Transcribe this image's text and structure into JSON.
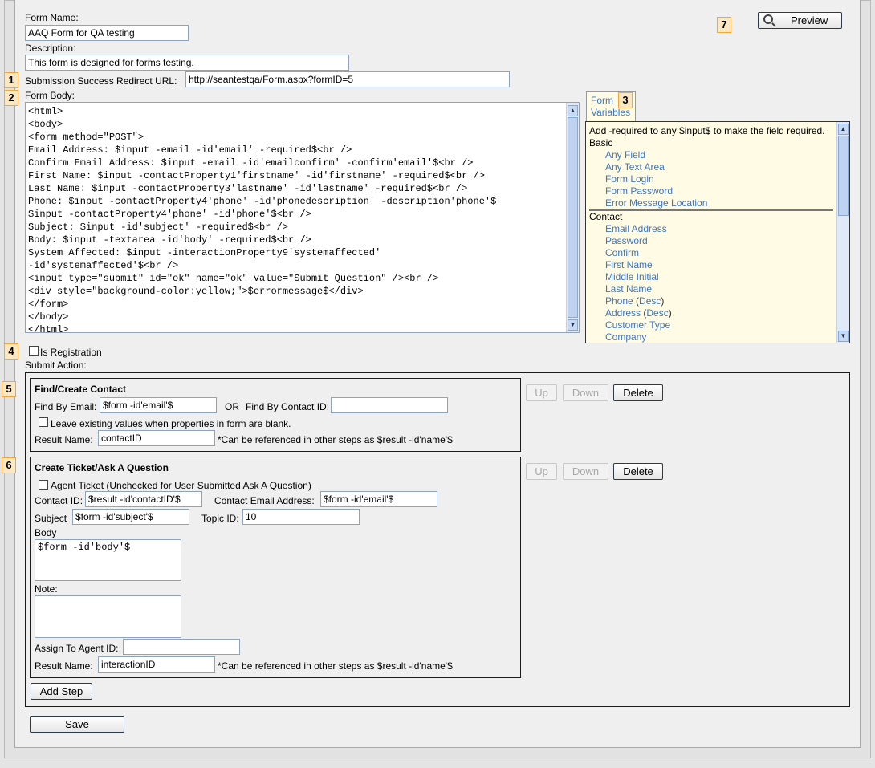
{
  "form_name": {
    "label": "Form Name:",
    "value": "AAQ Form for QA testing"
  },
  "description": {
    "label": "Description:",
    "value": "This form is designed for forms testing."
  },
  "redirect": {
    "label": "Submission Success Redirect URL:",
    "value": "http://seantestqa/Form.aspx?formID=5"
  },
  "form_body": {
    "label": "Form Body:",
    "lines": [
      "<html>",
      "<body>",
      "<form method=\"POST\">",
      "Email Address: $input -email -id'email' -required$<br />",
      "Confirm Email Address: $input -email -id'emailconfirm' -confirm'email'$<br />",
      "First Name: $input -contactProperty1'firstname' -id'firstname' -required$<br />",
      "Last Name: $input -contactProperty3'lastname' -id'lastname' -required$<br />",
      "Phone: $input -contactProperty4'phone' -id'phonedescription' -description'phone'$",
      "$input -contactProperty4'phone' -id'phone'$<br />",
      "Subject: $input -id'subject' -required$<br />",
      "Body: $input -textarea -id'body' -required$<br />",
      "System Affected: $input -interactionProperty9'systemaffected'",
      "-id'systemaffected'$<br />",
      "<input type=\"submit\" id=\"ok\" name=\"ok\" value=\"Submit Question\" /><br />",
      "<div style=\"background-color:yellow;\">$errormessage$</div>",
      "</form>",
      "</body>",
      "</html>"
    ]
  },
  "variables": {
    "tab_line1": "Form",
    "tab_line2": "Variables",
    "hint": "Add -required to any $input$ to make the field required.",
    "basic_title": "Basic",
    "basic_items": [
      "Any Field",
      "Any Text Area",
      "Form Login",
      "Form Password",
      "Error Message Location"
    ],
    "contact_title": "Contact",
    "contact_items": [
      "Email Address",
      "Password",
      "Confirm",
      "First Name",
      "Middle Initial",
      "Last Name",
      "Phone",
      "Address",
      "Customer Type",
      "Company"
    ],
    "desc": "Desc"
  },
  "markers": [
    "1",
    "2",
    "3",
    "4",
    "5",
    "6",
    "7"
  ],
  "preview_label": "Preview",
  "is_registration": "Is Registration",
  "submit_action": "Submit Action:",
  "step1": {
    "title": "Find/Create Contact",
    "find_email_label": "Find By Email:",
    "find_email_value": "$form -id'email'$",
    "or": "OR",
    "find_id_label": "Find By Contact ID:",
    "find_id_value": "",
    "leave_label": "Leave existing values when properties in form are blank.",
    "result_label": "Result Name:",
    "result_value": "contactID",
    "result_note": "*Can be referenced in other steps as $result -id'name'$"
  },
  "step2": {
    "title": "Create Ticket/Ask A Question",
    "agent_label": "Agent Ticket (Unchecked for User Submitted Ask A Question)",
    "contact_id_label": "Contact ID:",
    "contact_id_value": "$result -id'contactID'$",
    "contact_email_label": "Contact Email Address:",
    "contact_email_value": "$form -id'email'$",
    "subject_label": "Subject",
    "subject_value": "$form -id'subject'$",
    "topic_label": "Topic ID:",
    "topic_value": "10",
    "body_label": "Body",
    "body_value": "$form -id'body'$",
    "note_label": "Note:",
    "note_value": "",
    "assign_label": "Assign To Agent ID:",
    "assign_value": "",
    "result_label": "Result Name:",
    "result_value": "interactionID",
    "result_note": "*Can be referenced in other steps as $result -id'name'$"
  },
  "step_buttons": {
    "up": "Up",
    "down": "Down",
    "delete": "Delete"
  },
  "add_step": "Add Step",
  "save": "Save"
}
